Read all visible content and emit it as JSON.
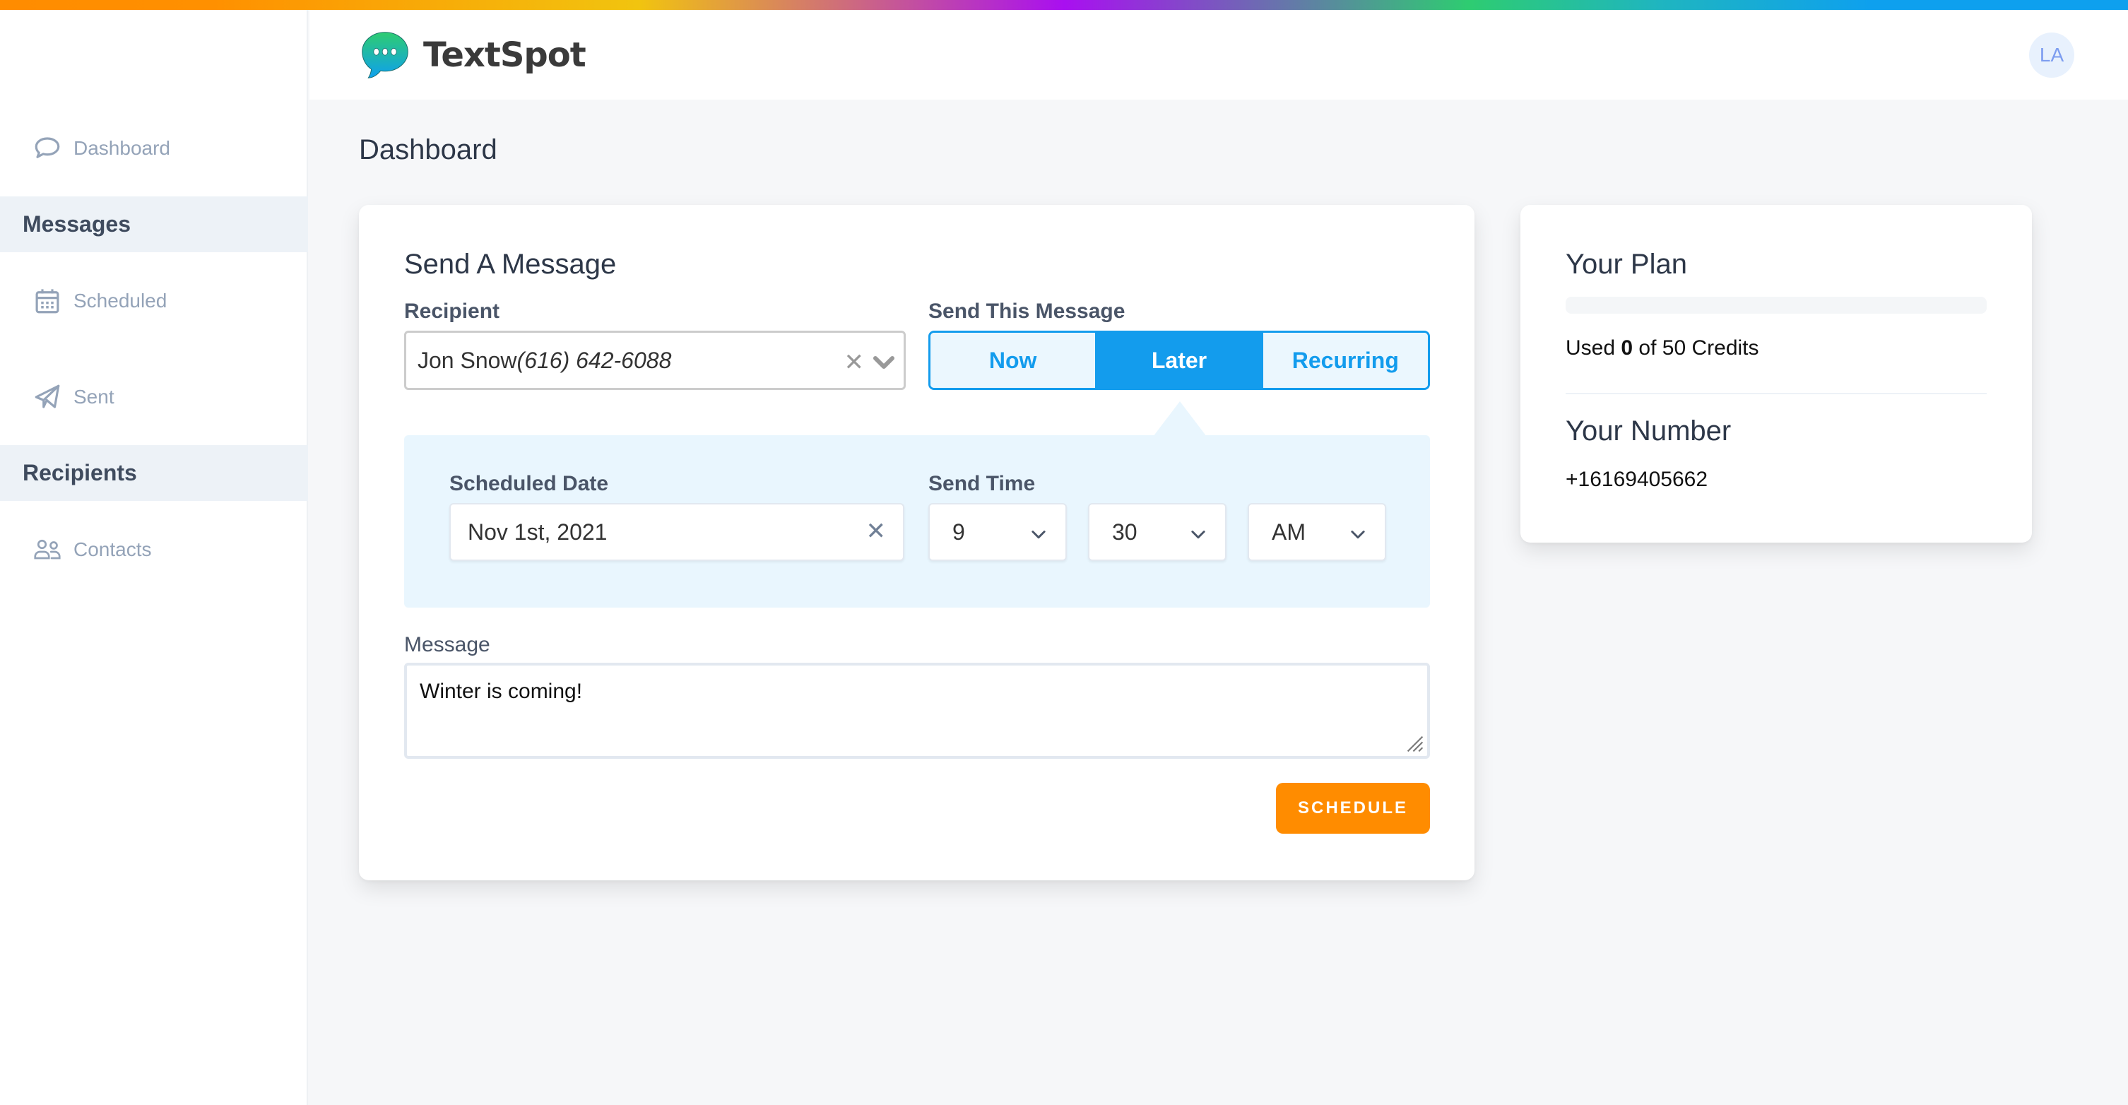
{
  "brand": {
    "name": "TextSpot",
    "gradient_colors": [
      "#ff8c00",
      "#f1c40f",
      "#a90ff0",
      "#2ecc71",
      "#0ea0ee"
    ],
    "accent_color": "#139ced",
    "action_color": "#ff8c00"
  },
  "header": {
    "avatar_initials": "LA"
  },
  "sidebar": {
    "items": [
      {
        "type": "link",
        "label": "Dashboard",
        "icon": "chat-bubble-icon"
      },
      {
        "type": "section",
        "label": "Messages"
      },
      {
        "type": "link",
        "label": "Scheduled",
        "icon": "calendar-icon"
      },
      {
        "type": "link",
        "label": "Sent",
        "icon": "paper-plane-icon"
      },
      {
        "type": "section",
        "label": "Recipients"
      },
      {
        "type": "link",
        "label": "Contacts",
        "icon": "users-icon"
      }
    ]
  },
  "page": {
    "title": "Dashboard"
  },
  "send_message": {
    "title": "Send A Message",
    "recipient_label": "Recipient",
    "recipient_name": "Jon Snow",
    "recipient_phone": "(616) 642-6088",
    "send_mode_label": "Send This Message",
    "send_modes": [
      {
        "label": "Now",
        "selected": false
      },
      {
        "label": "Later",
        "selected": true
      },
      {
        "label": "Recurring",
        "selected": false
      }
    ],
    "scheduled_date_label": "Scheduled Date",
    "scheduled_date_value": "Nov 1st, 2021",
    "send_time_label": "Send Time",
    "hour_value": "9",
    "minute_value": "30",
    "meridiem_value": "AM",
    "message_label": "Message",
    "message_value": "Winter is coming!",
    "schedule_button": "SCHEDULE"
  },
  "plan": {
    "title": "Your Plan",
    "credits_used": 0,
    "credits_total": 50,
    "usage_prefix": "Used",
    "usage_used": "0",
    "usage_suffix": "of 50 Credits",
    "number_title": "Your Number",
    "number_value": "+16169405662"
  }
}
